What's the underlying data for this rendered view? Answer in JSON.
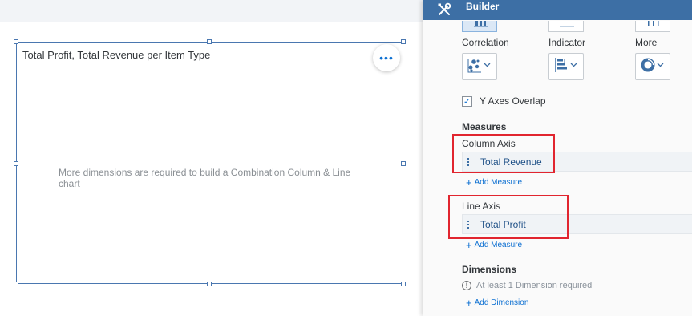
{
  "widget": {
    "title": "Total Profit, Total Revenue per Item Type",
    "more_glyph": "•••",
    "empty_message": "More dimensions are required to build a Combination Column & Line chart"
  },
  "builder": {
    "title": "Builder",
    "header_icon": "tools-icon",
    "chart_types": [
      {
        "label": "Correlation",
        "icon": "bubble-chart-icon"
      },
      {
        "label": "Indicator",
        "icon": "indicator-bar-chart-icon"
      },
      {
        "label": "More",
        "icon": "donut-chart-icon"
      }
    ],
    "y_axes_overlap": {
      "label": "Y Axes Overlap",
      "checked": true
    },
    "measures": {
      "title": "Measures",
      "column_axis": {
        "label": "Column Axis",
        "value": "Total Revenue",
        "add_label": "Add Measure"
      },
      "line_axis": {
        "label": "Line Axis",
        "value": "Total Profit",
        "add_label": "Add Measure"
      }
    },
    "dimensions": {
      "title": "Dimensions",
      "info": "At least 1 Dimension required",
      "add_label": "Add Dimension"
    }
  },
  "colors": {
    "header": "#3d6fa5",
    "accent": "#0a6ed1",
    "highlight": "#e1252f"
  }
}
